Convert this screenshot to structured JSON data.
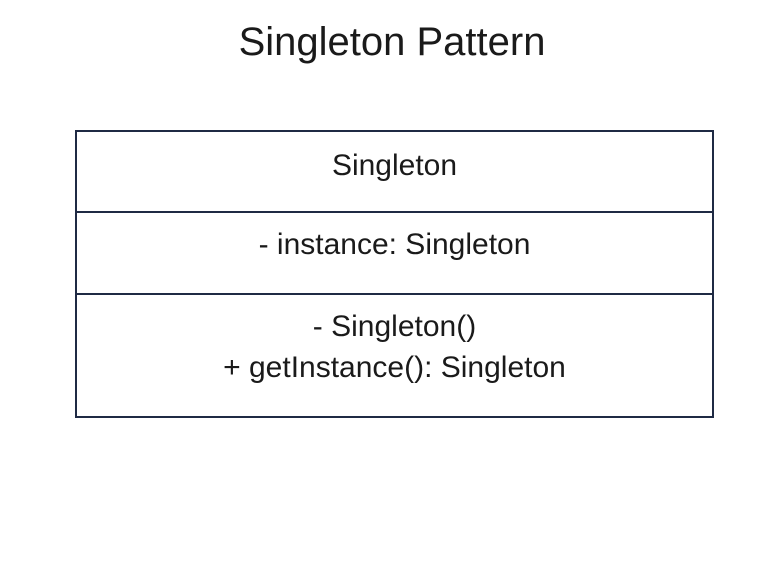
{
  "title": "Singleton Pattern",
  "uml": {
    "class_name": "Singleton",
    "attributes": [
      "-  instance: Singleton"
    ],
    "operations": [
      "- Singleton()",
      "+  getInstance(): Singleton"
    ]
  }
}
